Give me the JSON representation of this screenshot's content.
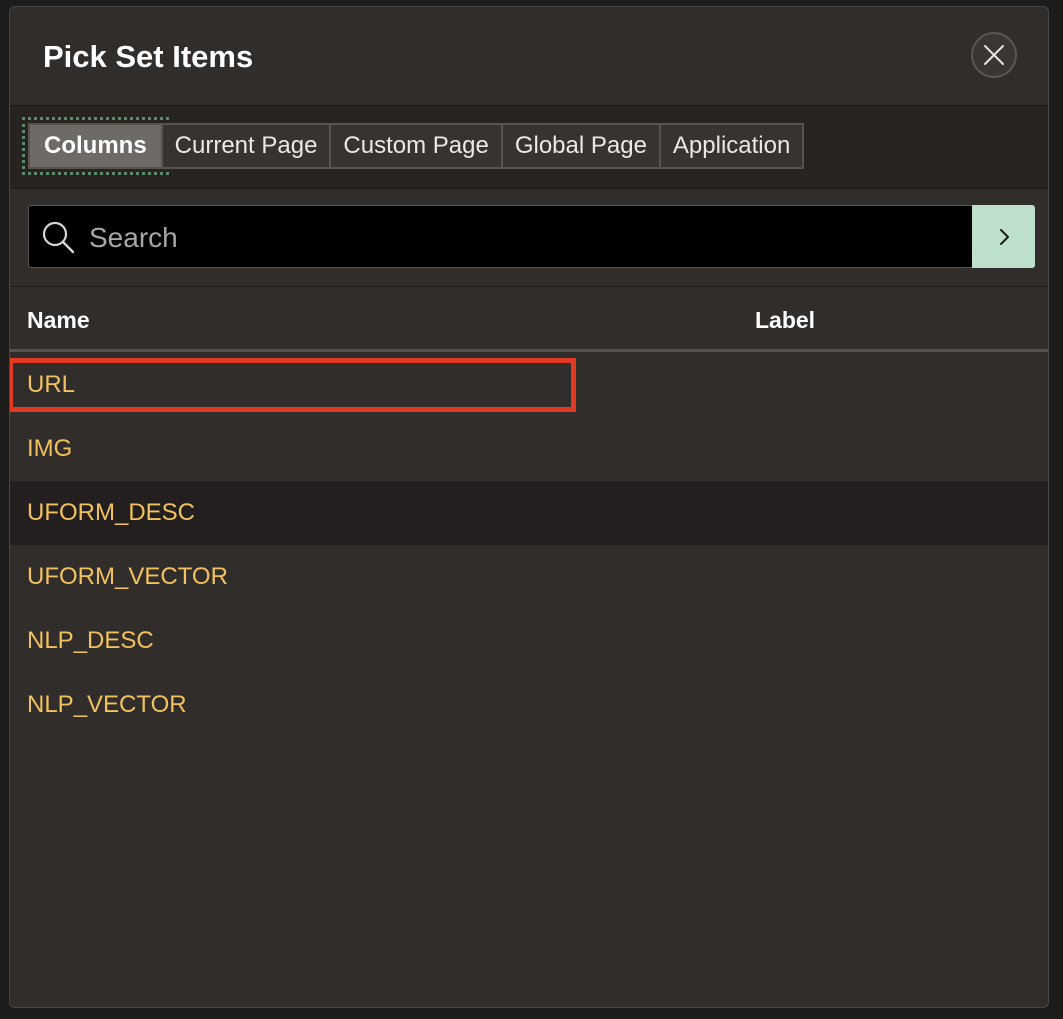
{
  "dialog": {
    "title": "Pick Set Items",
    "close_icon": "close-icon"
  },
  "tabs": [
    {
      "label": "Columns",
      "active": true
    },
    {
      "label": "Current Page",
      "active": false
    },
    {
      "label": "Custom Page",
      "active": false
    },
    {
      "label": "Global Page",
      "active": false
    },
    {
      "label": "Application",
      "active": false
    }
  ],
  "search": {
    "placeholder": "Search",
    "value": "",
    "icon": "search-icon",
    "go_icon": "chevron-right-icon"
  },
  "table": {
    "columns": [
      "Name",
      "Label"
    ],
    "rows": [
      {
        "name": "URL",
        "label": "",
        "highlighted": true
      },
      {
        "name": "IMG",
        "label": ""
      },
      {
        "name": "UFORM_DESC",
        "label": "",
        "hovered": true
      },
      {
        "name": "UFORM_VECTOR",
        "label": ""
      },
      {
        "name": "NLP_DESC",
        "label": ""
      },
      {
        "name": "NLP_VECTOR",
        "label": ""
      }
    ]
  },
  "colors": {
    "dialog_bg": "#312d2b",
    "item_text": "#f1c15f",
    "highlight": "#e03a23",
    "go_button": "#bfe0cb"
  }
}
